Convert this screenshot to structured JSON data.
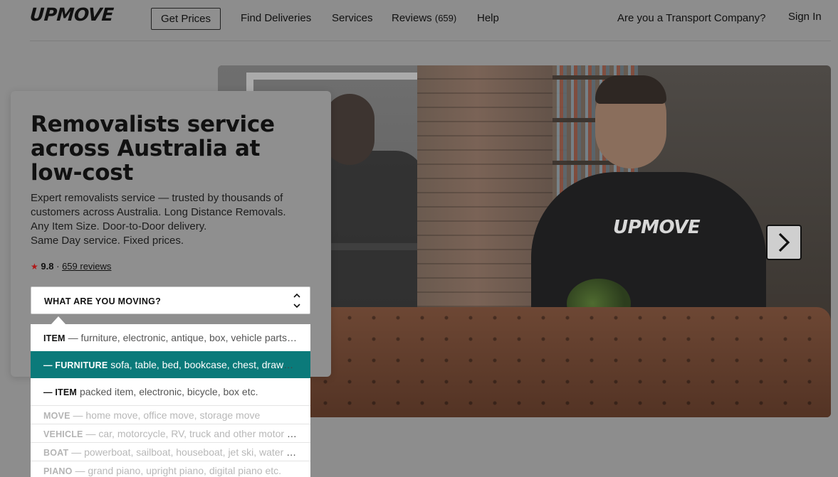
{
  "header": {
    "logo": "UPMOVE",
    "nav": {
      "get_prices": "Get Prices",
      "find_deliveries": "Find Deliveries",
      "services": "Services",
      "reviews": "Reviews",
      "reviews_count": "(659)",
      "help": "Help",
      "transport_company": "Are you a Transport Company?",
      "sign_in": "Sign In"
    }
  },
  "hero": {
    "shirt_logo": "UPMOVE",
    "next_icon": "chevron-right-icon"
  },
  "card": {
    "title": "Removalists service across Australia at low-cost",
    "description_lines": [
      "Expert removalists service — trusted by thousands of",
      "customers across Australia. Long Distance Removals.",
      "Any Item Size. Door-to-Door delivery.",
      "Same Day service. Fixed prices."
    ],
    "rating": {
      "score": "9.8",
      "separator": "·",
      "reviews_link": "659 reviews"
    },
    "select": {
      "label": "WHAT ARE YOU MOVING?"
    }
  },
  "dropdown": {
    "options": [
      {
        "tag": "ITEM",
        "rest": "— furniture, electronic, antique, box, vehicle parts, etc."
      },
      {
        "tag": "— FURNITURE",
        "rest": "sofa, table, bed, bookcase, chest, drawers, etc."
      },
      {
        "tag": "— ITEM",
        "rest": "packed item, electronic, bicycle, box etc."
      },
      {
        "tag": "MOVE",
        "rest": "— home move, office move, storage move"
      },
      {
        "tag": "VEHICLE",
        "rest": "— car, motorcycle, RV, truck and other motor vehicles"
      },
      {
        "tag": "BOAT",
        "rest": "— powerboat, sailboat, houseboat, jet ski, water craft"
      },
      {
        "tag": "PIANO",
        "rest": "— grand piano, upright piano, digital piano etc."
      }
    ]
  },
  "colors": {
    "accent": "#0b7a7a",
    "star": "#b01818",
    "overlay_background": "#8d8d8d"
  }
}
